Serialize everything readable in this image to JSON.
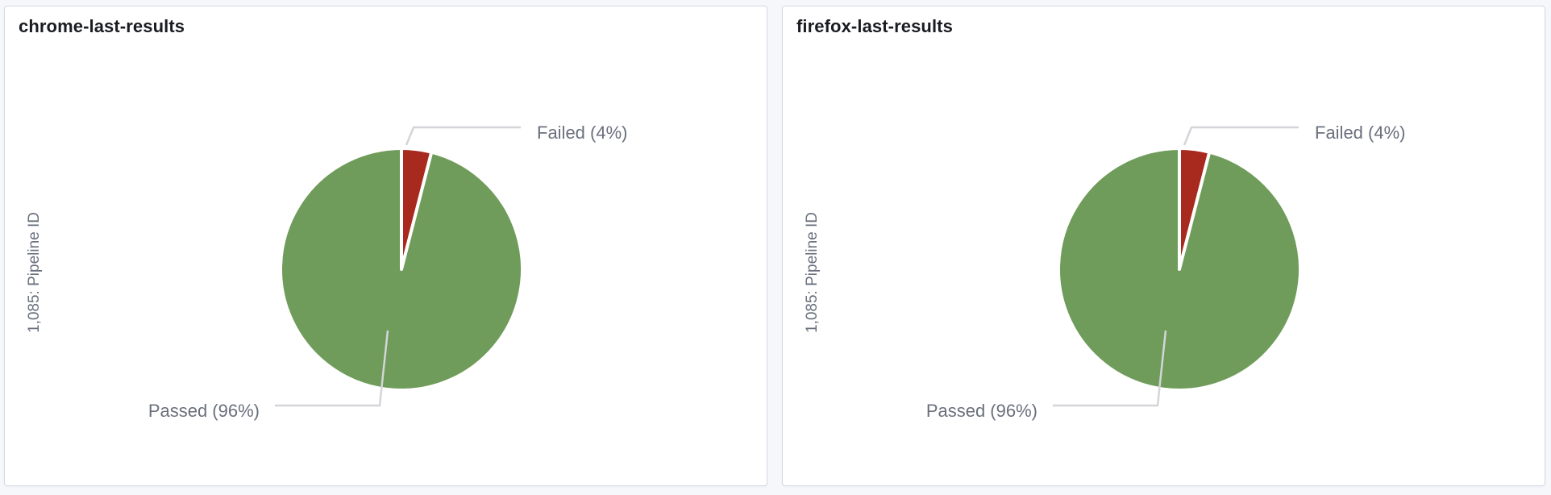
{
  "panels": [
    {
      "title": "chrome-last-results",
      "axis_label": "1,085: Pipeline ID",
      "labels": {
        "failed": "Failed (4%)",
        "passed": "Passed (96%)"
      }
    },
    {
      "title": "firefox-last-results",
      "axis_label": "1,085: Pipeline ID",
      "labels": {
        "failed": "Failed (4%)",
        "passed": "Passed (96%)"
      }
    }
  ],
  "chart_data": [
    {
      "type": "pie",
      "title": "chrome-last-results",
      "categories": [
        "Failed",
        "Passed"
      ],
      "values": [
        4,
        96
      ],
      "colors": [
        "#a8291d",
        "#6f9c5a"
      ],
      "ylabel": "1,085: Pipeline ID"
    },
    {
      "type": "pie",
      "title": "firefox-last-results",
      "categories": [
        "Failed",
        "Passed"
      ],
      "values": [
        4,
        96
      ],
      "colors": [
        "#a8291d",
        "#6f9c5a"
      ],
      "ylabel": "1,085: Pipeline ID"
    }
  ]
}
